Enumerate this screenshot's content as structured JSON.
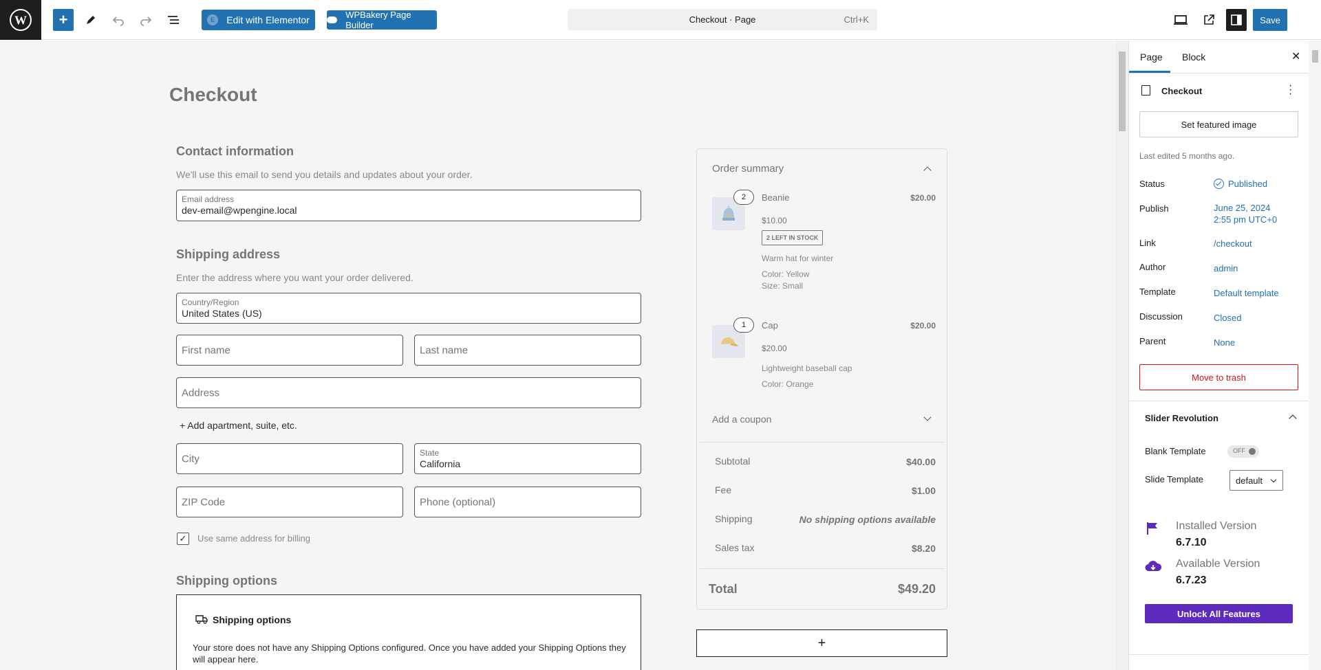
{
  "toolbar": {
    "elementor_label": "Edit with Elementor",
    "wpbakery_label": "WPBakery Page Builder",
    "command_title": "Checkout · Page",
    "command_shortcut": "Ctrl+K",
    "save_label": "Save"
  },
  "page": {
    "title": "Checkout",
    "contact": {
      "heading": "Contact information",
      "description": "We'll use this email to send you details and updates about your order.",
      "email_label": "Email address",
      "email_value": "dev-email@wpengine.local"
    },
    "shipping_address": {
      "heading": "Shipping address",
      "description": "Enter the address where you want your order delivered.",
      "country_label": "Country/Region",
      "country_value": "United States (US)",
      "first_name_placeholder": "First name",
      "last_name_placeholder": "Last name",
      "address_placeholder": "Address",
      "add_apartment": "+ Add apartment, suite, etc.",
      "city_placeholder": "City",
      "state_label": "State",
      "state_value": "California",
      "zip_placeholder": "ZIP Code",
      "phone_placeholder": "Phone (optional)",
      "billing_checkbox_label": "Use same address for billing",
      "billing_checked": true
    },
    "shipping_options": {
      "heading": "Shipping options",
      "box_title": "Shipping options",
      "box_text": "Your store does not have any Shipping Options configured. Once you have added your Shipping Options they will appear here."
    }
  },
  "order_summary": {
    "heading": "Order summary",
    "items": [
      {
        "qty": "2",
        "name": "Beanie",
        "total": "$20.00",
        "unit_price": "$10.00",
        "stock_badge": "2 LEFT IN STOCK",
        "description": "Warm hat for winter",
        "attr1": "Color: Yellow",
        "attr2": "Size: Small"
      },
      {
        "qty": "1",
        "name": "Cap",
        "total": "$20.00",
        "unit_price": "$20.00",
        "description": "Lightweight baseball cap",
        "attr1": "Color: Orange"
      }
    ],
    "coupon_label": "Add a coupon",
    "subtotal_label": "Subtotal",
    "subtotal_value": "$40.00",
    "fee_label": "Fee",
    "fee_value": "$1.00",
    "shipping_label": "Shipping",
    "shipping_value": "No shipping options available",
    "tax_label": "Sales tax",
    "tax_value": "$8.20",
    "total_label": "Total",
    "total_value": "$49.20",
    "append_symbol": "+"
  },
  "sidebar": {
    "tabs": [
      "Page",
      "Block"
    ],
    "close_symbol": "✕",
    "doc_title": "Checkout",
    "featured_image_button": "Set featured image",
    "last_edited": "Last edited 5 months ago.",
    "meta": {
      "status_label": "Status",
      "status_value": "Published",
      "publish_label": "Publish",
      "publish_date": "June 25, 2024",
      "publish_time": "2:55 pm UTC+0",
      "link_label": "Link",
      "link_value": "/checkout",
      "author_label": "Author",
      "author_value": "admin",
      "template_label": "Template",
      "template_value": "Default template",
      "discussion_label": "Discussion",
      "discussion_value": "Closed",
      "parent_label": "Parent",
      "parent_value": "None"
    },
    "trash_button": "Move to trash",
    "slider_revolution": {
      "title": "Slider Revolution",
      "blank_template_label": "Blank Template",
      "blank_template_toggle": "OFF",
      "slide_template_label": "Slide Template",
      "slide_template_value": "default",
      "installed_label": "Installed Version",
      "installed_value": "6.7.10",
      "available_label": "Available Version",
      "available_value": "6.7.23",
      "unlock_button": "Unlock All Features"
    }
  },
  "colors": {
    "wp_blue": "#2271b1",
    "danger": "#cc1818",
    "slider_purple": "#5c2bbd"
  }
}
